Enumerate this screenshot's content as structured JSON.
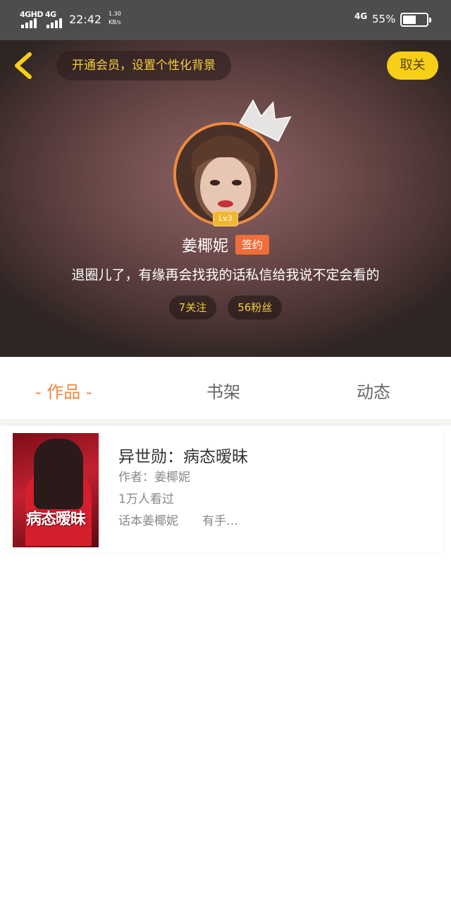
{
  "status_bar": {
    "net1": "4GHD",
    "net2": "4G",
    "time": "22:42",
    "speed_value": "1.30",
    "speed_unit": "KB/s",
    "net_right": "4G",
    "battery_pct": "55%",
    "battery_level": 0.55
  },
  "header": {
    "promo_text": "开通会员，设置个性化背景",
    "cancel_follow_label": "取关",
    "level": "Lv3",
    "name": "姜椰妮",
    "sign_badge": "签约",
    "bio": "退圈儿了，有缘再会找我的话私信给我说不定会看的",
    "following": "7关注",
    "fans": "56粉丝"
  },
  "tabs": {
    "works": "- 作品 -",
    "shelf": "书架",
    "moments": "动态"
  },
  "book": {
    "cover_title": "病态暧昧",
    "title": "异世勋：病态暧昧",
    "author": "作者：姜椰妮",
    "views": "1万人看过",
    "desc": "话本姜椰妮　　有手…"
  },
  "colors": {
    "accent": "#f08a3e",
    "gold": "#f4cf3a",
    "cancel_bg": "#f7cf17",
    "status_bar": "#4c4d4f"
  }
}
